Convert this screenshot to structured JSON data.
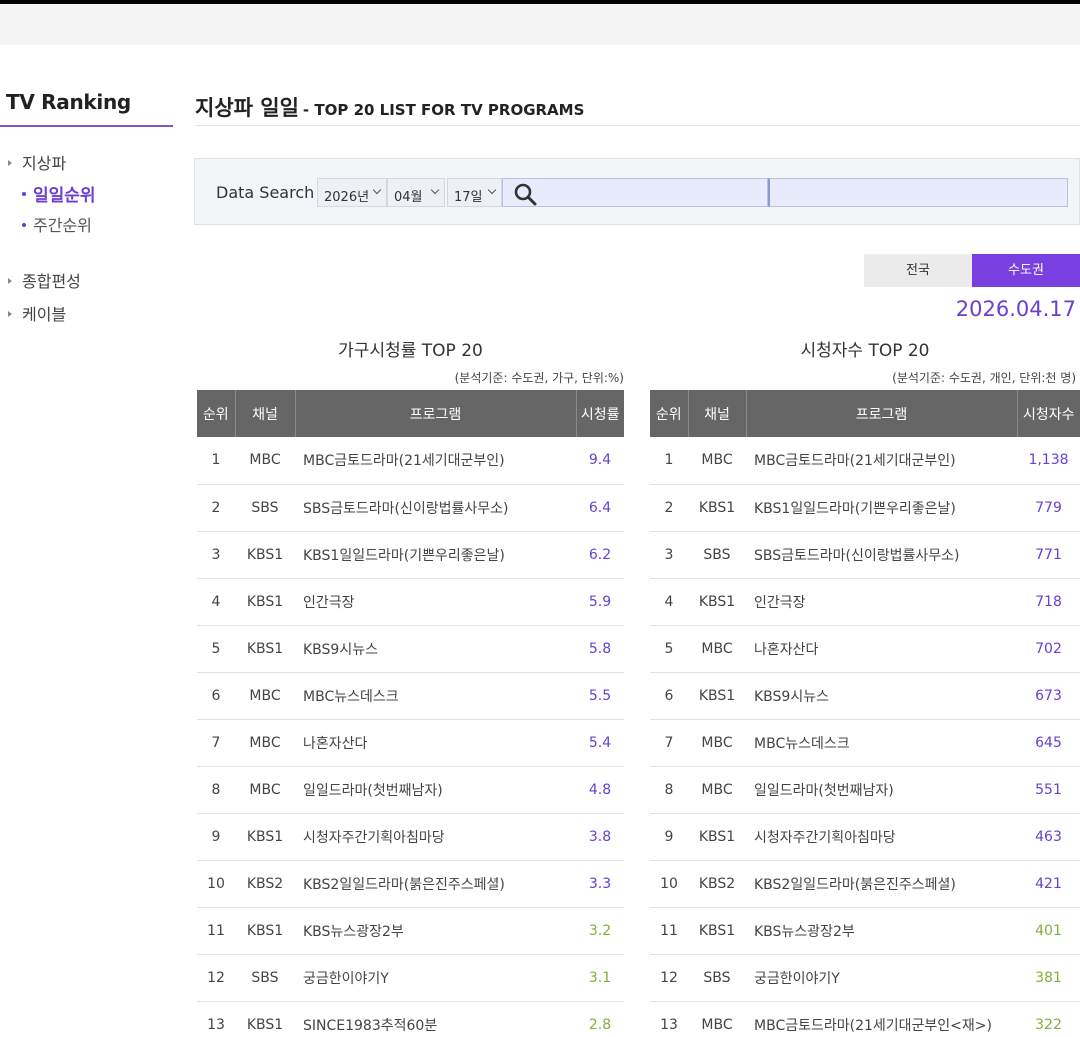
{
  "sidebar": {
    "title": "TV Ranking",
    "items": [
      {
        "label": "지상파"
      },
      {
        "label": "종합편성"
      },
      {
        "label": "케이블"
      }
    ],
    "sub_items": [
      {
        "label": "일일순위",
        "active": true
      },
      {
        "label": "주간순위",
        "active": false
      }
    ]
  },
  "header": {
    "title": "지상파 일일",
    "subtitle": "- TOP 20 LIST FOR TV PROGRAMS"
  },
  "search": {
    "label": "Data Search",
    "year": "2026년",
    "month": "04월",
    "day": "17일",
    "search_icon": "search-icon"
  },
  "region_tabs": [
    {
      "label": "전국",
      "active": false
    },
    {
      "label": "수도권",
      "active": true
    }
  ],
  "date": "2026.04.17",
  "colors": {
    "accent": "#6a3fd1",
    "tab_active": "#7a3fe0",
    "low_value": "#7fb13a",
    "header_bg": "#666666"
  },
  "household_table": {
    "title": "가구시청률 TOP 20",
    "note": "(분석기준: 수도권, 가구, 단위:%)",
    "headers": [
      "순위",
      "채널",
      "프로그램",
      "시청률"
    ],
    "rows": [
      {
        "rank": "1",
        "channel": "MBC",
        "program": "MBC금토드라마(21세기대군부인)",
        "value": "9.4"
      },
      {
        "rank": "2",
        "channel": "SBS",
        "program": "SBS금토드라마(신이랑법률사무소)",
        "value": "6.4"
      },
      {
        "rank": "3",
        "channel": "KBS1",
        "program": "KBS1일일드라마(기쁜우리좋은날)",
        "value": "6.2"
      },
      {
        "rank": "4",
        "channel": "KBS1",
        "program": "인간극장",
        "value": "5.9"
      },
      {
        "rank": "5",
        "channel": "KBS1",
        "program": "KBS9시뉴스",
        "value": "5.8"
      },
      {
        "rank": "6",
        "channel": "MBC",
        "program": "MBC뉴스데스크",
        "value": "5.5"
      },
      {
        "rank": "7",
        "channel": "MBC",
        "program": "나혼자산다",
        "value": "5.4"
      },
      {
        "rank": "8",
        "channel": "MBC",
        "program": "일일드라마(첫번째남자)",
        "value": "4.8"
      },
      {
        "rank": "9",
        "channel": "KBS1",
        "program": "시청자주간기획아침마당",
        "value": "3.8"
      },
      {
        "rank": "10",
        "channel": "KBS2",
        "program": "KBS2일일드라마(붉은진주스페셜)",
        "value": "3.3"
      },
      {
        "rank": "11",
        "channel": "KBS1",
        "program": "KBS뉴스광장2부",
        "value": "3.2"
      },
      {
        "rank": "12",
        "channel": "SBS",
        "program": "궁금한이야기Y",
        "value": "3.1"
      },
      {
        "rank": "13",
        "channel": "KBS1",
        "program": "SINCE1983추적60분",
        "value": "2.8"
      }
    ]
  },
  "viewers_table": {
    "title": "시청자수 TOP 20",
    "note": "(분석기준: 수도권, 개인, 단위:천 명)",
    "headers": [
      "순위",
      "채널",
      "프로그램",
      "시청자수"
    ],
    "rows": [
      {
        "rank": "1",
        "channel": "MBC",
        "program": "MBC금토드라마(21세기대군부인)",
        "value": "1,138"
      },
      {
        "rank": "2",
        "channel": "KBS1",
        "program": "KBS1일일드라마(기쁜우리좋은날)",
        "value": "779"
      },
      {
        "rank": "3",
        "channel": "SBS",
        "program": "SBS금토드라마(신이랑법률사무소)",
        "value": "771"
      },
      {
        "rank": "4",
        "channel": "KBS1",
        "program": "인간극장",
        "value": "718"
      },
      {
        "rank": "5",
        "channel": "MBC",
        "program": "나혼자산다",
        "value": "702"
      },
      {
        "rank": "6",
        "channel": "KBS1",
        "program": "KBS9시뉴스",
        "value": "673"
      },
      {
        "rank": "7",
        "channel": "MBC",
        "program": "MBC뉴스데스크",
        "value": "645"
      },
      {
        "rank": "8",
        "channel": "MBC",
        "program": "일일드라마(첫번째남자)",
        "value": "551"
      },
      {
        "rank": "9",
        "channel": "KBS1",
        "program": "시청자주간기획아침마당",
        "value": "463"
      },
      {
        "rank": "10",
        "channel": "KBS2",
        "program": "KBS2일일드라마(붉은진주스페셜)",
        "value": "421"
      },
      {
        "rank": "11",
        "channel": "KBS1",
        "program": "KBS뉴스광장2부",
        "value": "401"
      },
      {
        "rank": "12",
        "channel": "SBS",
        "program": "궁금한이야기Y",
        "value": "381"
      },
      {
        "rank": "13",
        "channel": "MBC",
        "program": "MBC금토드라마(21세기대군부인<재>)",
        "value": "322"
      }
    ]
  }
}
